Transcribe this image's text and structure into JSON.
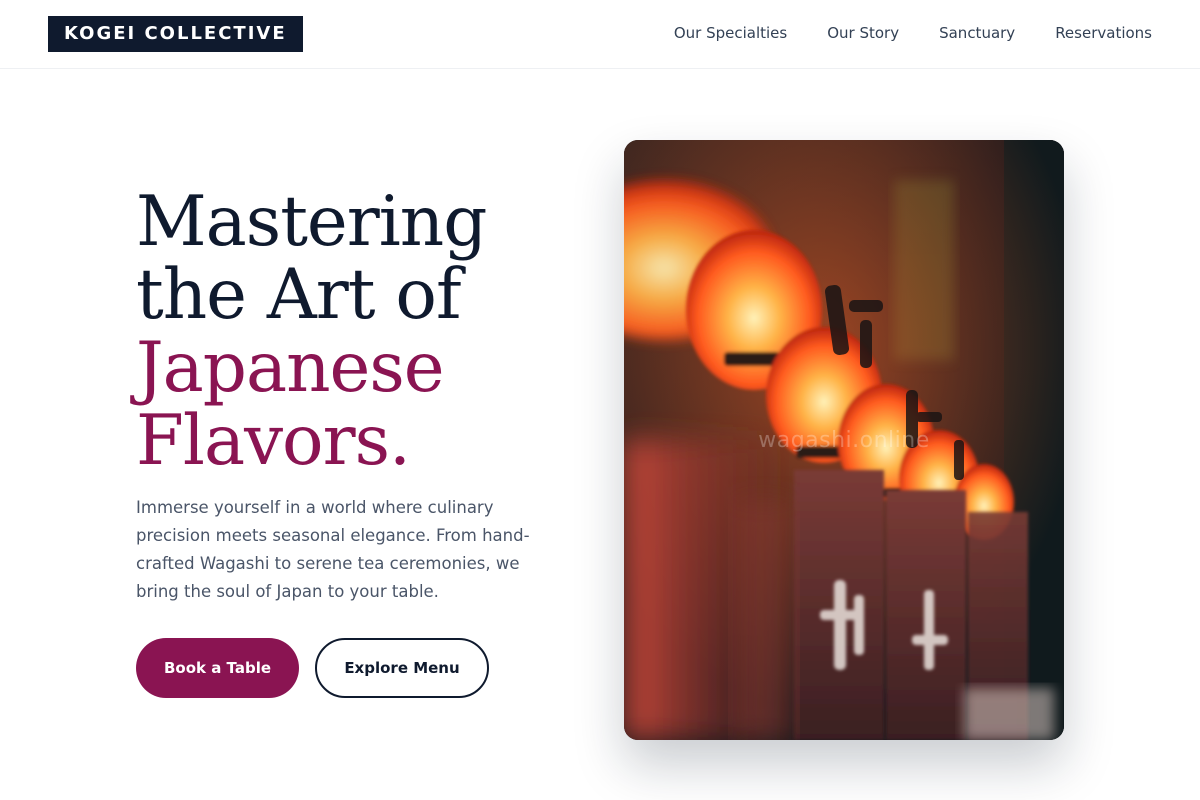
{
  "brand": {
    "logo_text": "KOGEI COLLECTIVE"
  },
  "nav": {
    "items": [
      {
        "label": "Our Specialties"
      },
      {
        "label": "Our Story"
      },
      {
        "label": "Sanctuary"
      },
      {
        "label": "Reservations"
      }
    ]
  },
  "hero": {
    "title_lines": [
      "Mastering",
      "the Art of"
    ],
    "title_accent_lines": [
      "Japanese",
      "Flavors."
    ],
    "description": "Immerse yourself in a world where culinary precision meets seasonal elegance. From hand-crafted Wagashi to serene tea ceremonies, we bring the soul of Japan to your table.",
    "primary_button": "Book a Table",
    "secondary_button": "Explore Menu"
  },
  "image": {
    "subject": "red paper lanterns with Japanese calligraphy hanging at a night street stall",
    "watermark": "wagashi.online"
  },
  "colors": {
    "navy": "#0f1a2e",
    "accent": "#8a1452",
    "body_text": "#4a5568",
    "nav_text": "#334155"
  }
}
